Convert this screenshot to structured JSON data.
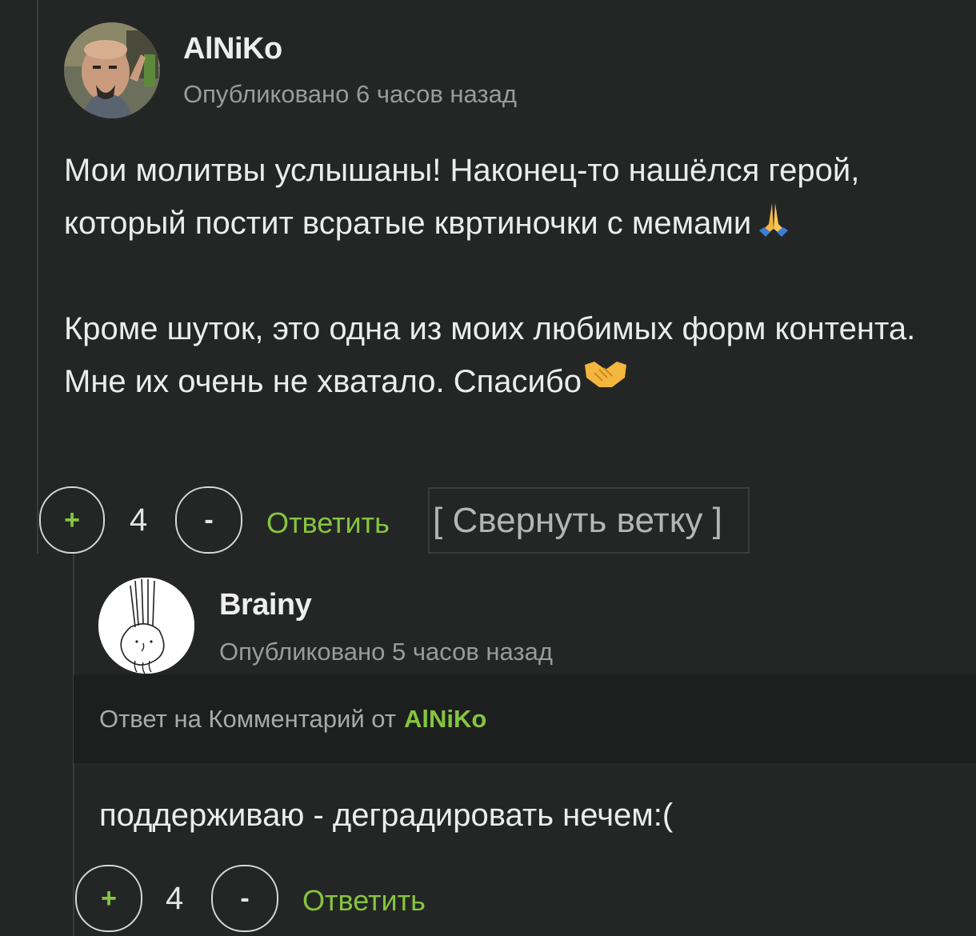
{
  "comments": [
    {
      "author": "AlNiKo",
      "published": "Опубликовано 6 часов назад",
      "paragraphs": [
        "Мои молитвы услышаны! Наконец-то нашёлся герой, который постит всратые квртиночки с мемами",
        "Кроме шуток, это одна из моих любимых форм контента. Мне их очень не хватало. Спасибо"
      ],
      "emoji_after_p1": "pray-emoji",
      "emoji_after_p2": "handshake-emoji",
      "rating": "4",
      "plus_label": "+",
      "minus_label": "-",
      "reply_label": "Ответить",
      "collapse_label": "[ Свернуть ветку ]"
    },
    {
      "author": "Brainy",
      "published": "Опубликовано 5 часов назад",
      "reply_to_prefix": "Ответ на Комментарий от",
      "reply_to_author": "AlNiKo",
      "text": "поддерживаю - деградировать нечем:(",
      "rating": "4",
      "plus_label": "+",
      "minus_label": "-",
      "reply_label": "Ответить"
    }
  ],
  "colors": {
    "background": "#242625",
    "accent_green": "#86c440",
    "muted_text": "#9a9c9b"
  }
}
